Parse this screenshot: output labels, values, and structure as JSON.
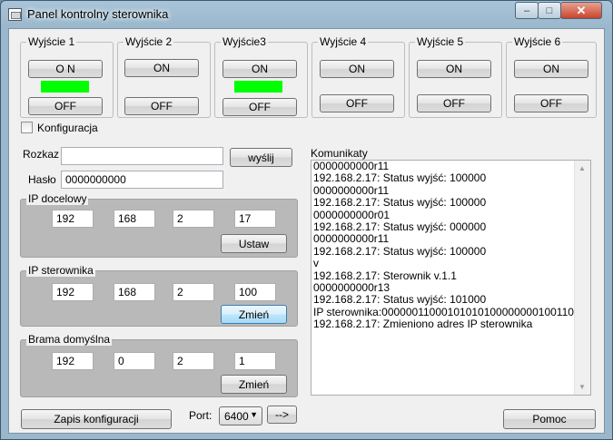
{
  "window": {
    "title": "Panel kontrolny sterownika"
  },
  "outputs": [
    {
      "label": "Wyjście 1",
      "on": "O N",
      "off": "OFF",
      "active": true
    },
    {
      "label": "Wyjście 2",
      "on": "ON",
      "off": "OFF",
      "active": false
    },
    {
      "label": "Wyjście3",
      "on": "ON",
      "off": "OFF",
      "active": true
    },
    {
      "label": "Wyjście 4",
      "on": "ON",
      "off": "OFF",
      "active": false
    },
    {
      "label": "Wyjście 5",
      "on": "ON",
      "off": "OFF",
      "active": false
    },
    {
      "label": "Wyjście 6",
      "on": "ON",
      "off": "OFF",
      "active": false
    }
  ],
  "colors": {
    "active_indicator": "#00ff00"
  },
  "config": {
    "checkbox_label": "Konfiguracja",
    "checked": false
  },
  "command": {
    "label": "Rozkaz",
    "value": "",
    "send_button": "wyślij"
  },
  "password": {
    "label": "Hasło",
    "value": "0000000000"
  },
  "target_ip": {
    "title": "IP docelowy",
    "octets": [
      "192",
      "168",
      "2",
      "17"
    ],
    "button": "Ustaw"
  },
  "controller_ip": {
    "title": "IP sterownika",
    "octets": [
      "192",
      "168",
      "2",
      "100"
    ],
    "button": "Zmień"
  },
  "gateway": {
    "title": "Brama domyślna",
    "octets": [
      "192",
      "0",
      "2",
      "1"
    ],
    "button": "Zmień"
  },
  "messages": {
    "label": "Komunikaty",
    "lines": [
      "0000000000r11",
      "192.168.2.17: Status wyjść:  100000",
      "0000000000r11",
      "192.168.2.17: Status wyjść:  100000",
      "0000000000r01",
      "192.168.2.17: Status wyjść:  000000",
      "0000000000r11",
      "192.168.2.17: Status wyjść:  100000",
      "v",
      "192.168.2.17:  Sterownik v.1.1",
      "0000000000r13",
      "192.168.2.17: Status wyjść:  101000",
      "IP sterownika:00000011000101010100000000100110",
      "192.168.2.17: Zmieniono adres IP sterownika"
    ]
  },
  "footer": {
    "save_button": "Zapis konfiguracji",
    "port_label": "Port:",
    "port_value": "6400",
    "go_button": "-->",
    "help_button": "Pomoc"
  },
  "titlebar": {
    "minimize": "–",
    "maximize": "□",
    "close": "✕"
  }
}
